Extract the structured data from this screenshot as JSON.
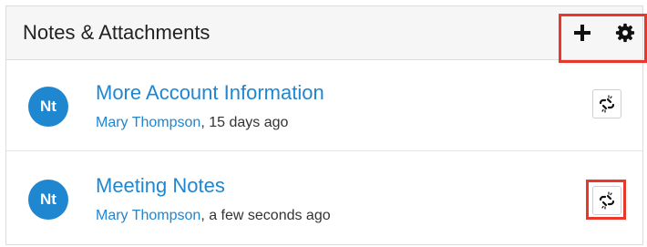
{
  "panel": {
    "title": "Notes & Attachments",
    "actions": [
      {
        "icon": "plus-icon"
      },
      {
        "icon": "gear-icon"
      }
    ],
    "highlight_color": "#e8382c"
  },
  "notes": [
    {
      "avatar": "Nt",
      "title": "More Account Information",
      "author": "Mary Thompson",
      "time": ", 15 days ago",
      "action_icon": "unlink-icon"
    },
    {
      "avatar": "Nt",
      "title": "Meeting Notes",
      "author": "Mary Thompson",
      "time": ", a few seconds ago",
      "action_icon": "unlink-icon"
    }
  ],
  "colors": {
    "accent": "#1f86d0",
    "header_bg": "#f6f6f6",
    "highlight": "#e8382c"
  }
}
